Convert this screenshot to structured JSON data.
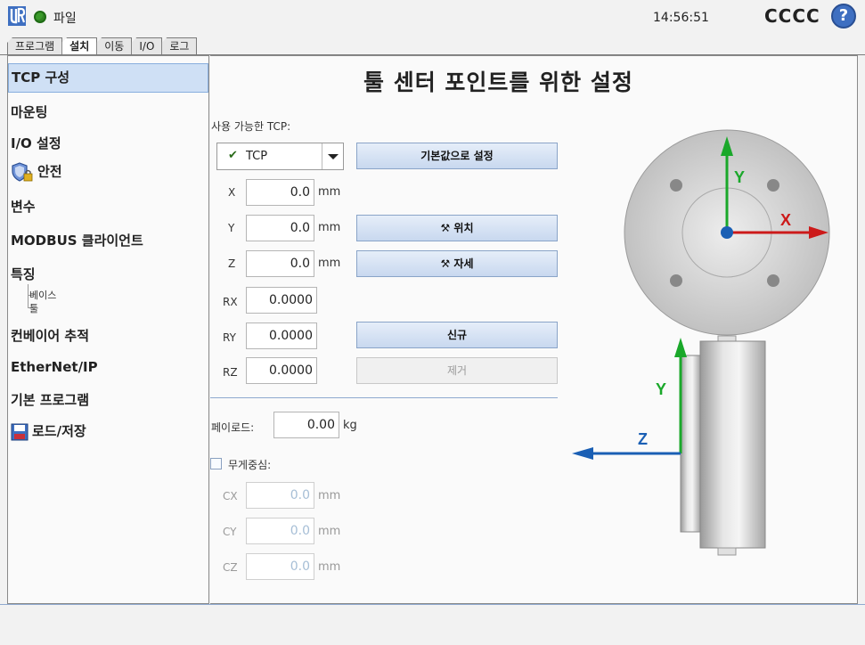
{
  "header": {
    "file_label": "파일",
    "time": "14:56:51",
    "robot_name": "CCCC",
    "help_label": "?"
  },
  "tabs": [
    {
      "label": "프로그램"
    },
    {
      "label": "설치"
    },
    {
      "label": "이동"
    },
    {
      "label": "I/O"
    },
    {
      "label": "로그"
    }
  ],
  "sidebar": {
    "items": [
      {
        "label": "TCP 구성"
      },
      {
        "label": "마운팅"
      },
      {
        "label": "I/O 설정"
      },
      {
        "label": "안전"
      },
      {
        "label": "변수"
      },
      {
        "label": "MODBUS 클라이언트"
      },
      {
        "label": "특징"
      },
      {
        "label": "컨베이어 추적"
      },
      {
        "label": "EtherNet/IP"
      },
      {
        "label": "기본 프로그램"
      },
      {
        "label": "로드/저장"
      }
    ],
    "features_children": [
      "베이스",
      "툴"
    ]
  },
  "main": {
    "title": "툴 센터 포인트를 위한 설정",
    "available_tcp_label": "사용 가능한 TCP:",
    "tcp_selected": "TCP",
    "set_default_button": "기본값으로 설정",
    "position_button": "위치",
    "orientation_button": "자세",
    "new_button": "신규",
    "remove_button": "제거",
    "coords": {
      "x": {
        "label": "X",
        "value": "0.0",
        "unit": "mm"
      },
      "y": {
        "label": "Y",
        "value": "0.0",
        "unit": "mm"
      },
      "z": {
        "label": "Z",
        "value": "0.0",
        "unit": "mm"
      },
      "rx": {
        "label": "RX",
        "value": "0.0000"
      },
      "ry": {
        "label": "RY",
        "value": "0.0000"
      },
      "rz": {
        "label": "RZ",
        "value": "0.0000"
      }
    },
    "payload": {
      "label": "페이로드:",
      "value": "0.00",
      "unit": "kg"
    },
    "cog": {
      "label": "무게중심:",
      "cx": {
        "label": "CX",
        "value": "0.0",
        "unit": "mm"
      },
      "cy": {
        "label": "CY",
        "value": "0.0",
        "unit": "mm"
      },
      "cz": {
        "label": "CZ",
        "value": "0.0",
        "unit": "mm"
      }
    },
    "diagram": {
      "axis_x": "X",
      "axis_y": "Y",
      "axis_y2": "Y",
      "axis_z": "Z"
    }
  },
  "colors": {
    "accent": "#3e6fc1",
    "status_ok": "#3a9a2a",
    "selected_bg": "#cfe0f5",
    "axis_x": "#cc1a1a",
    "axis_y": "#1aa82a",
    "axis_z": "#1a5fb4"
  }
}
